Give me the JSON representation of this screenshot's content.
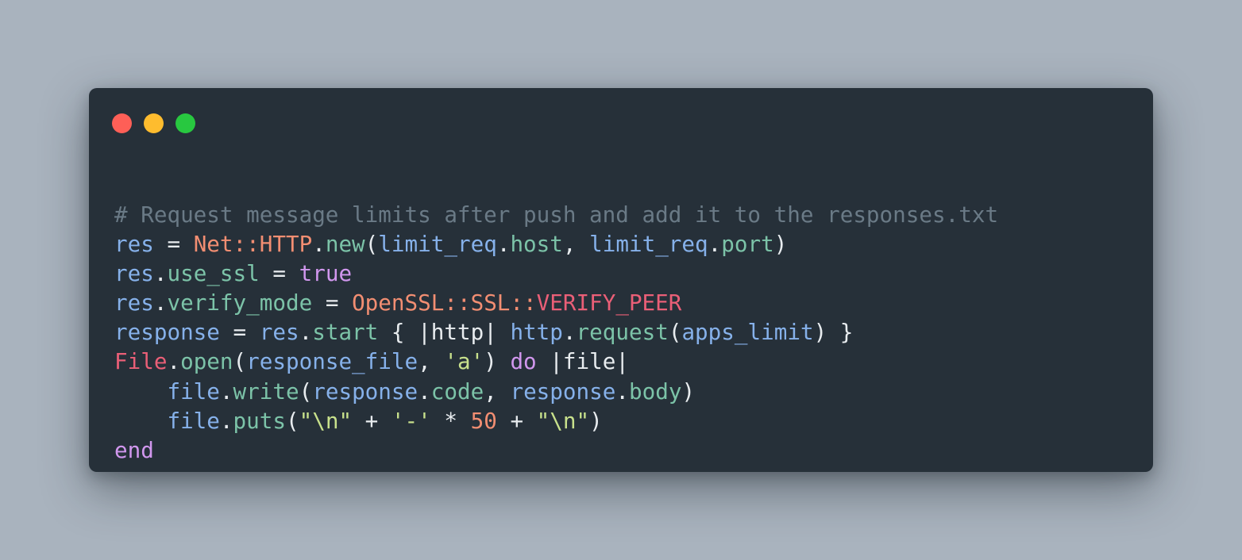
{
  "window": {
    "controls": [
      {
        "name": "close",
        "color": "#fe5f57"
      },
      {
        "name": "minimize",
        "color": "#febc2e"
      },
      {
        "name": "zoom",
        "color": "#28c840"
      }
    ]
  },
  "code": {
    "language": "ruby",
    "lines": [
      [
        {
          "t": "comment",
          "v": "# Request message limits after push and add it to the responses.txt"
        }
      ],
      [
        {
          "t": "var",
          "v": "res"
        },
        {
          "t": "punct",
          "v": " = "
        },
        {
          "t": "class",
          "v": "Net::HTTP"
        },
        {
          "t": "punct",
          "v": "."
        },
        {
          "t": "method",
          "v": "new"
        },
        {
          "t": "punct",
          "v": "("
        },
        {
          "t": "var",
          "v": "limit_req"
        },
        {
          "t": "punct",
          "v": "."
        },
        {
          "t": "method",
          "v": "host"
        },
        {
          "t": "punct",
          "v": ", "
        },
        {
          "t": "var",
          "v": "limit_req"
        },
        {
          "t": "punct",
          "v": "."
        },
        {
          "t": "method",
          "v": "port"
        },
        {
          "t": "punct",
          "v": ")"
        }
      ],
      [
        {
          "t": "var",
          "v": "res"
        },
        {
          "t": "punct",
          "v": "."
        },
        {
          "t": "method",
          "v": "use_ssl"
        },
        {
          "t": "punct",
          "v": " = "
        },
        {
          "t": "keyword",
          "v": "true"
        }
      ],
      [
        {
          "t": "var",
          "v": "res"
        },
        {
          "t": "punct",
          "v": "."
        },
        {
          "t": "method",
          "v": "verify_mode"
        },
        {
          "t": "punct",
          "v": " = "
        },
        {
          "t": "class",
          "v": "OpenSSL::SSL::"
        },
        {
          "t": "const",
          "v": "VERIFY_PEER"
        }
      ],
      [
        {
          "t": "var",
          "v": "response"
        },
        {
          "t": "punct",
          "v": " = "
        },
        {
          "t": "var",
          "v": "res"
        },
        {
          "t": "punct",
          "v": "."
        },
        {
          "t": "method",
          "v": "start"
        },
        {
          "t": "punct",
          "v": " { |http| "
        },
        {
          "t": "var",
          "v": "http"
        },
        {
          "t": "punct",
          "v": "."
        },
        {
          "t": "method",
          "v": "request"
        },
        {
          "t": "punct",
          "v": "("
        },
        {
          "t": "var",
          "v": "apps_limit"
        },
        {
          "t": "punct",
          "v": ") }"
        }
      ],
      [
        {
          "t": "const",
          "v": "File"
        },
        {
          "t": "punct",
          "v": "."
        },
        {
          "t": "method",
          "v": "open"
        },
        {
          "t": "punct",
          "v": "("
        },
        {
          "t": "var",
          "v": "response_file"
        },
        {
          "t": "punct",
          "v": ", "
        },
        {
          "t": "string",
          "v": "'a'"
        },
        {
          "t": "punct",
          "v": ") "
        },
        {
          "t": "keyword",
          "v": "do"
        },
        {
          "t": "punct",
          "v": " |file|"
        }
      ],
      [
        {
          "t": "punct",
          "v": "    "
        },
        {
          "t": "var",
          "v": "file"
        },
        {
          "t": "punct",
          "v": "."
        },
        {
          "t": "method",
          "v": "write"
        },
        {
          "t": "punct",
          "v": "("
        },
        {
          "t": "var",
          "v": "response"
        },
        {
          "t": "punct",
          "v": "."
        },
        {
          "t": "method",
          "v": "code"
        },
        {
          "t": "punct",
          "v": ", "
        },
        {
          "t": "var",
          "v": "response"
        },
        {
          "t": "punct",
          "v": "."
        },
        {
          "t": "method",
          "v": "body"
        },
        {
          "t": "punct",
          "v": ")"
        }
      ],
      [
        {
          "t": "punct",
          "v": "    "
        },
        {
          "t": "var",
          "v": "file"
        },
        {
          "t": "punct",
          "v": "."
        },
        {
          "t": "method",
          "v": "puts"
        },
        {
          "t": "punct",
          "v": "("
        },
        {
          "t": "string",
          "v": "\"\\n\""
        },
        {
          "t": "punct",
          "v": " + "
        },
        {
          "t": "string",
          "v": "'-'"
        },
        {
          "t": "punct",
          "v": " * "
        },
        {
          "t": "number",
          "v": "50"
        },
        {
          "t": "punct",
          "v": " + "
        },
        {
          "t": "string",
          "v": "\"\\n\""
        },
        {
          "t": "punct",
          "v": ")"
        }
      ],
      [
        {
          "t": "keyword",
          "v": "end"
        }
      ]
    ]
  }
}
